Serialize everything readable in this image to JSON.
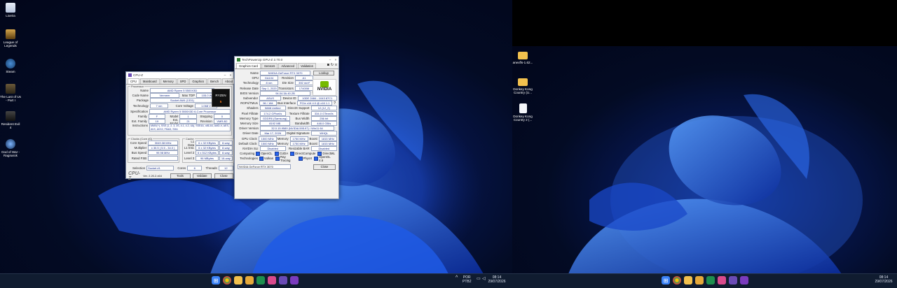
{
  "desktop_left": {
    "icons": [
      {
        "label": "Lixeira",
        "icon": "recycle-bin"
      },
      {
        "label": "League of Legends",
        "icon": "league-of-legends"
      },
      {
        "label": "Steam",
        "icon": "steam"
      },
      {
        "label": "The Last of Us - Part I",
        "icon": "the-last-of-us"
      },
      {
        "label": "Resident Evil 4",
        "icon": "resident-evil-4"
      },
      {
        "label": "God of War - Ragnarok",
        "icon": "god-of-war"
      }
    ]
  },
  "desktop_right": {
    "icons": [
      {
        "label": "anexfls-1.62...",
        "icon": "folder"
      },
      {
        "label": "Donkey Kong Country (U...",
        "icon": "folder"
      },
      {
        "label": "Donkey Kong Country 2 (...",
        "icon": "file"
      }
    ]
  },
  "cpuz": {
    "title": "CPU-Z",
    "tabs": [
      "CPU",
      "Mainboard",
      "Memory",
      "SPD",
      "Graphics",
      "Bench",
      "About"
    ],
    "processor_group": "Processor",
    "name_label": "Name",
    "name": "AMD Ryzen 5 5500X3D",
    "codename_label": "Code Name",
    "codename": "Vermeer",
    "maxtdp_label": "Max TDP",
    "maxtdp": "105.0 W",
    "package_label": "Package",
    "package": "Socket AM4 (1331)",
    "technology_label": "Technology",
    "technology": "7 nm",
    "corevoltage_label": "Core Voltage",
    "corevoltage": "1.068 V",
    "spec_label": "Specification",
    "spec": "AMD Ryzen 5 5500X3D 6-Core Processor",
    "family_label": "Family",
    "family": "F",
    "model_label": "Model",
    "model": "1",
    "stepping_label": "Stepping",
    "stepping": "0",
    "extfamily_label": "Ext. Family",
    "extfamily": "19",
    "extmodel_label": "Ext. Model",
    "extmodel": "21",
    "revision_label": "Revision",
    "revision": "VMR-B2",
    "instructions_label": "Instructions",
    "instructions": "MMX(+), SSE (1, 2, 3, 3S, 4.1, 4.2, 4A), SSE4A, x86-64, AMD-V, AES, AVX, AVX2, FMA3, SHA",
    "clocks_group": "Clocks (Core #0)",
    "corespeed_label": "Core Speed",
    "corespeed": "3049.38 MHz",
    "multiplier_label": "Multiplier",
    "multiplier": "x 30.5 ( 5.5 - 34.0 )",
    "busspeed_label": "Bus Speed",
    "busspeed": "99.98 MHz",
    "ratedfsb_label": "Rated FSB",
    "ratedfsb": "",
    "cache_group": "Cache",
    "l1d_label": "L1 Data",
    "l1d": "6 x 32 KBytes",
    "l1d_way": "8-way",
    "l1i_label": "L1 Inst.",
    "l1i": "6 x 32 KBytes",
    "l1i_way": "8-way",
    "l2_label": "Level 2",
    "l2": "6 x 512 KBytes",
    "l2_way": "8-way",
    "l3_label": "Level 3",
    "l3": "96 MBytes",
    "l3_way": "16-way",
    "selection_label": "Selection",
    "selection": "Socket #1",
    "cores_label": "Cores",
    "cores": "6",
    "threads_label": "Threads",
    "threads": "12",
    "brand": "CPU-Z",
    "version": "Ver. 2.20.2.x64",
    "tools_btn": "Tools",
    "validate_btn": "Validate",
    "close_btn": "Close",
    "logo_text": "RYZEN",
    "logo_sub": "5"
  },
  "gpuz": {
    "title": "TechPowerUp GPU-Z 2.70.0",
    "tabs": [
      "Graphics Card",
      "Sensors",
      "Advanced",
      "Validation"
    ],
    "name_label": "Name",
    "name": "NVIDIA GeForce RTX 3070",
    "lookup_btn": "Lookup",
    "gpu_label": "GPU",
    "gpu": "GA104",
    "revision_label": "Revision",
    "revision": "A1",
    "tech_label": "Technology",
    "tech": "8 nm",
    "diesize_label": "Die Size",
    "diesize": "392 mm²",
    "release_label": "Release Date",
    "release": "Sep 1, 2020",
    "transistors_label": "Transistors",
    "transistors": "17400M",
    "bios_label": "BIOS Version",
    "bios": "94.04.3A.40.2B",
    "uefi": "UEFI",
    "subvendor_label": "Subvendor",
    "subvendor": "ASUS",
    "deviceid_label": "Device ID",
    "deviceid": "10DE 2484 - 1043 87C1",
    "rops_label": "ROPs/TMUs",
    "rops": "96 / 184",
    "businterface_label": "Bus Interface",
    "businterface": "PCIe x16 4.0 @ x16 1.1",
    "shaders_label": "Shaders",
    "shaders": "5888 Unified",
    "directx_label": "DirectX Support",
    "directx": "12 (12_2)",
    "pixelfill_label": "Pixel Fillrate",
    "pixelfill": "174.2 GPixel/s",
    "texturefill_label": "Texture Fillrate",
    "texturefill": "334.0 GTexel/s",
    "memtype_label": "Memory Type",
    "memtype": "GDDR6 (Samsung)",
    "buswidth_label": "Bus Width",
    "buswidth": "256 bit",
    "memsize_label": "Memory Size",
    "memsize": "8192 MB",
    "bandwidth_label": "Bandwidth",
    "bandwidth": "448.0 GB/s",
    "driverver_label": "Driver Version",
    "driverver": "32.0.15.9589 (NVIDIA 595.97) / Win11 64",
    "driverdate_label": "Driver Date",
    "driverdate": "Mar 17, 2026",
    "digsig_label": "Digital Signature",
    "digsig": "WHQL",
    "gpuclock_label": "GPU Clock",
    "gpuclock": "1500 MHz",
    "memory_label": "Memory",
    "memory": "1750 MHz",
    "boost_label": "Boost",
    "boost": "1815 MHz",
    "defclock_label": "Default Clock",
    "defclock": "1500 MHz",
    "defmemory": "1750 MHz",
    "defboost": "1815 MHz",
    "sli_label": "NVIDIA SLI",
    "sli": "Disabled",
    "rebar_label": "Resizable BAR",
    "rebar": "Disabled",
    "computing_label": "Computing",
    "computing": [
      "OpenCL",
      "CUDA",
      "DirectCompute",
      "DirectML"
    ],
    "technologies_label": "Technologies",
    "technologies": [
      "Vulkan",
      "Ray Tracing",
      "PhysX",
      "OpenGL 4.6"
    ],
    "footer_select": "NVIDIA GeForce RTX 3070",
    "close_btn": "Close",
    "logo_text": "NVIDIA"
  },
  "taskbar_left": {
    "lang_line1": "POR",
    "lang_line2": "PTB2",
    "time": "08:14",
    "date": "29/07/2026"
  },
  "taskbar_right": {
    "time": "08:14",
    "date": "29/07/2026"
  },
  "colors": {
    "accent": "#2563eb",
    "taskbar": "#101c30",
    "nvidia_green": "#76b900",
    "cpuz_blue": "#1a2f8a"
  }
}
